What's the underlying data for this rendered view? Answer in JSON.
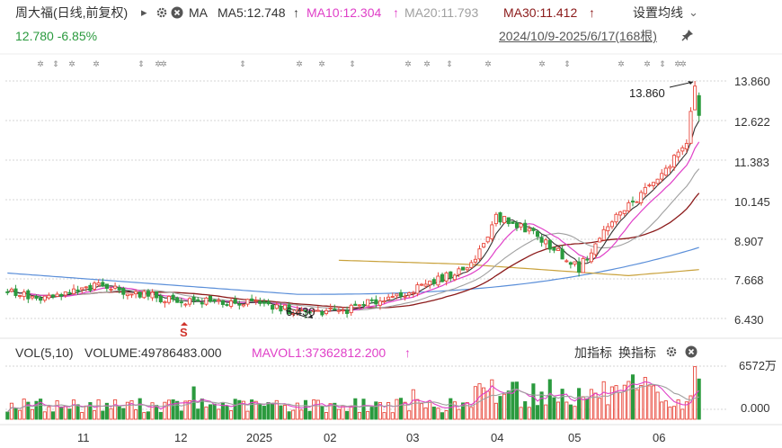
{
  "header": {
    "stock_title": "周大福(日线,前复权)",
    "ma_label": "MA",
    "ma5": "MA5:12.748",
    "ma10": "MA10:12.304",
    "ma20": "MA20:11.793",
    "ma30": "MA30:11.412",
    "arrow": "↑",
    "settings": "设置均线",
    "price_change": "12.780 -6.85%",
    "date_range": "2024/10/9-2025/6/17(168根)"
  },
  "colors": {
    "up": "#e8483c",
    "down": "#2b9a3e",
    "ma5": "#333333",
    "ma10": "#e040c8",
    "ma20": "#a0a0a0",
    "ma30": "#8b1a1a",
    "ma60": "#c9a23c",
    "ma120": "#5b8fd9",
    "green_text": "#2b9a3e"
  },
  "volume_header": {
    "vol_label": "VOL(5,10)",
    "volume": "VOLUME:49786483.000",
    "mavol": "MAVOL1:37362812.200",
    "arrow": "↑",
    "add_indicator": "加指标",
    "switch_indicator": "换指标"
  },
  "chart_data": {
    "type": "candlestick",
    "price_ticks": [
      "13.860",
      "12.622",
      "11.383",
      "10.145",
      "8.907",
      "7.668",
      "6.430"
    ],
    "price_range": [
      6.43,
      13.86
    ],
    "volume_ticks": [
      "6572万",
      "0.000"
    ],
    "x_labels": [
      "11",
      "12",
      "2025",
      "02",
      "03",
      "04",
      "05",
      "06"
    ],
    "annotations": {
      "high": "13.860",
      "low": "6.430",
      "s_marker": "S"
    },
    "bars": 168,
    "close_last": 12.78,
    "volume_last": 49786483,
    "mavol1_last": 37362812.2
  }
}
